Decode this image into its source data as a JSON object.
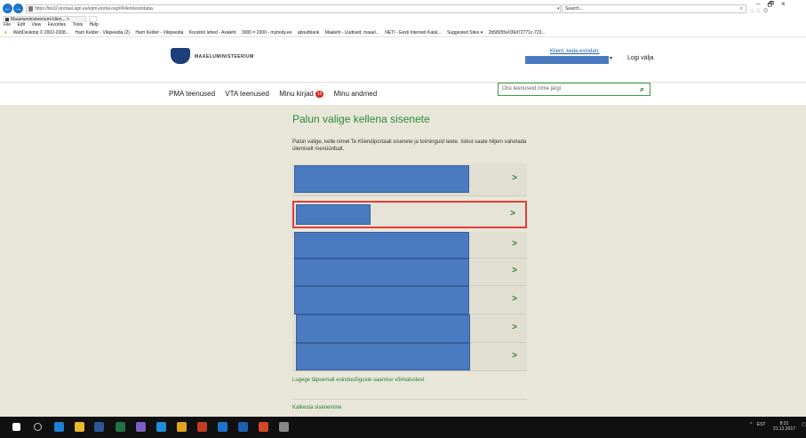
{
  "browser": {
    "url": "https://test2-portaal.agri.ee/epm-portal-reg/#/klient/esindatav",
    "addr_controls": "▾ C",
    "search_placeholder": "Search...",
    "tab_title": "Maaeluministeeriumi klien...",
    "tab_close": "×",
    "menu": [
      "File",
      "Edit",
      "View",
      "Favorites",
      "Tools",
      "Help"
    ],
    "favorites": [
      "WebDesktop © 2002-2008...",
      "Harri Kelder - Vikipeedia (2)",
      "Harri Kelder - Vikipeedia",
      "Koostöö lehed - Avaleht",
      "3000 = 2000 - mybody.ee",
      "aboutblank",
      "Maaleht - Uudised, maael...",
      "NETI - Eesti Interneti Katal...",
      "Suggested Sites ▾",
      "2b58055e036d72771c-723..."
    ],
    "window_controls": [
      "–",
      "🗗",
      "×"
    ]
  },
  "site": {
    "logo_text": "MAAELUMINISTEERIUM",
    "client_label": "Klient, keda esindan:",
    "logout": "Logi välja",
    "nav": {
      "pma": "PMA teenused",
      "vta": "VTA teenused",
      "letters": "Minu kirjad",
      "letters_count": "15",
      "mydata": "Minu andmed"
    },
    "search_placeholder": "Otsi teenuseid nime järgi"
  },
  "main": {
    "heading": "Palun valige kellena sisenete",
    "intro": "Palun valige, kelle nimel Te Kliendiportaali sisenete ja toiminguid teete. Isikut saate hiljem vahetada ülemiselt menüüribalt.",
    "rows": [
      {
        "chevron": ">",
        "selected": false
      },
      {
        "chevron": ">",
        "selected": true
      },
      {
        "chevron": ">",
        "selected": false
      },
      {
        "chevron": ">",
        "selected": false
      },
      {
        "chevron": ">",
        "selected": false
      },
      {
        "chevron": ">",
        "selected": false
      },
      {
        "chevron": ">",
        "selected": false
      }
    ],
    "more_link": "Lugege täpsemalt esindusõiguste saamise võimalustest",
    "cancel_link": "Katkesta sisenemine"
  },
  "taskbar": {
    "lang": "EST",
    "time": "8:31",
    "date": "21.12.2017"
  },
  "colors": {
    "accent_green": "#2c8a3a",
    "redaction_blue": "#4a7bc1",
    "selection_red": "#e53a3a",
    "badge_red": "#d9261c"
  }
}
